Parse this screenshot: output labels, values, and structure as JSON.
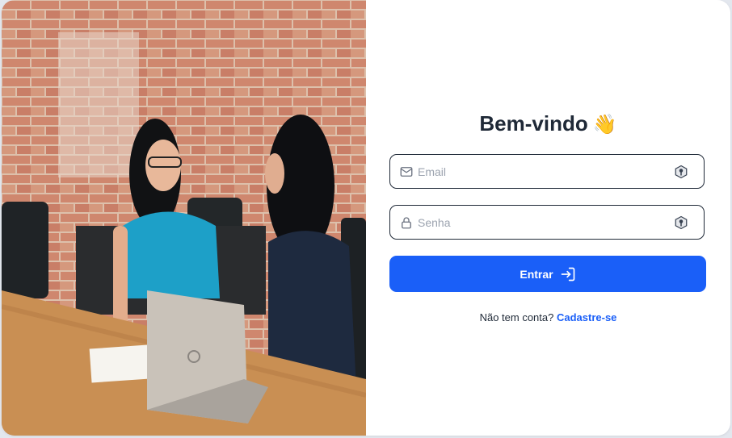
{
  "welcome": {
    "title": "Bem-vindo",
    "emoji": "👋"
  },
  "form": {
    "email": {
      "placeholder": "Email",
      "value": "",
      "icon": "mail-icon"
    },
    "password": {
      "placeholder": "Senha",
      "value": "",
      "icon": "lock-icon"
    },
    "submit_label": "Entrar",
    "submit_icon": "login-icon"
  },
  "signup": {
    "prompt": "Não tem conta?",
    "link_label": "Cadastre-se"
  },
  "colors": {
    "accent": "#1a5ff8",
    "text": "#1f2937",
    "placeholder": "#9ca3af"
  }
}
